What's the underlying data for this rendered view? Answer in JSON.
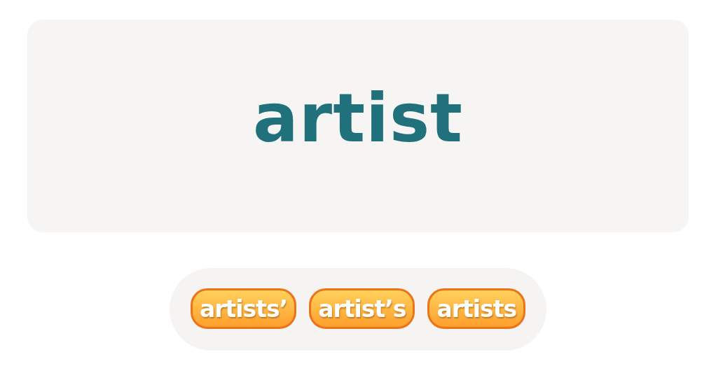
{
  "word": "artist",
  "options": [
    {
      "label": "artists’"
    },
    {
      "label": "artist’s"
    },
    {
      "label": "artists"
    }
  ]
}
